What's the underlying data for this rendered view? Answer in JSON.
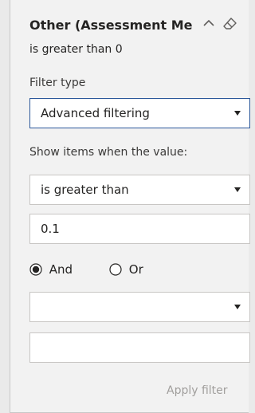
{
  "filter_card": {
    "title": "Other (Assessment Me",
    "summary": "is greater than 0",
    "filter_type_label": "Filter type",
    "filter_type_value": "Advanced filtering",
    "show_items_label": "Show items when the value:",
    "condition1": {
      "operator": "is greater than",
      "value": "0.1"
    },
    "logic": {
      "and_label": "And",
      "or_label": "Or",
      "selected": "And"
    },
    "condition2": {
      "operator": "",
      "value": ""
    },
    "apply_label": "Apply filter"
  },
  "icons": {
    "collapse": "chevron-up-icon",
    "clear": "eraser-icon",
    "dropdown": "caret-down-icon"
  },
  "colors": {
    "panel_bg": "#f2f2f2",
    "field_border": "#c8c6c4",
    "focus_border": "#2b579a",
    "disabled_text": "#a19f9d"
  }
}
